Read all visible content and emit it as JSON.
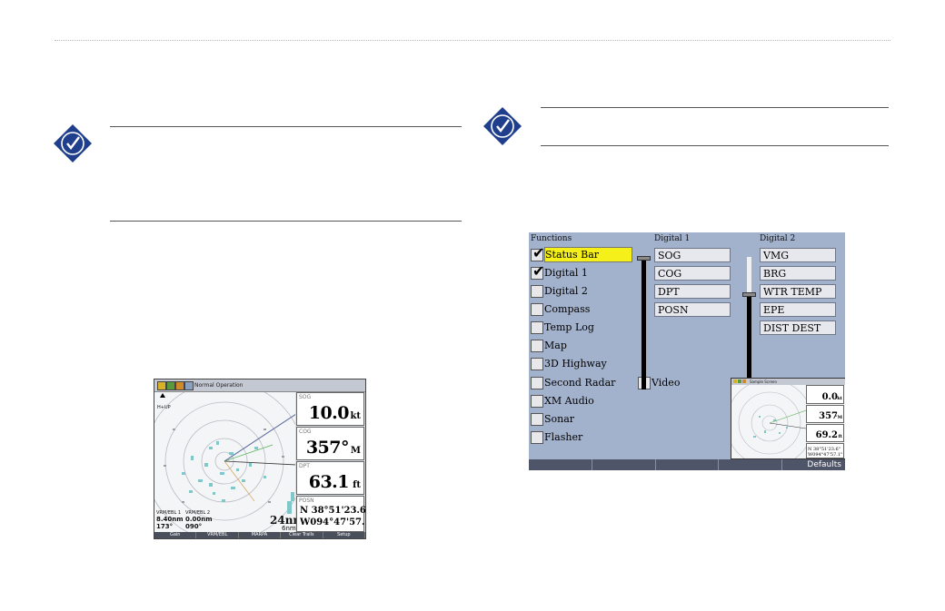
{
  "radar_screen": {
    "title": "Normal Operation",
    "panels": [
      {
        "label": "SOG",
        "value": "10.0",
        "unit": "kt"
      },
      {
        "label": "COG",
        "value": "357°",
        "unit": "M"
      },
      {
        "label": "DPT",
        "value": "63.1",
        "unit": "ft"
      }
    ],
    "posn": {
      "label": "POSN",
      "lat": "N  38°51'23.6\"",
      "lon": "W094°47'57.1\""
    },
    "range": "24nm",
    "range_sub": "6nm",
    "heading_mode": "H+UP",
    "readout_left_1": "VRM/EBL 1",
    "readout_left_2": "8.40nm",
    "readout_left_3": "173°",
    "readout_mid_1": "VRM/EBL 2",
    "readout_mid_2": "0.00nm",
    "readout_mid_3": "090°",
    "softkeys": [
      "Gain",
      "VRM/EBL",
      "MARPA",
      "Clear Trails",
      "Setup"
    ]
  },
  "layout_screen": {
    "functions_header": "Functions",
    "digital1_header": "Digital 1",
    "digital2_header": "Digital 2",
    "functions": [
      {
        "label": "Status Bar",
        "checked": true,
        "selected": true
      },
      {
        "label": "Digital 1",
        "checked": true,
        "selected": false
      },
      {
        "label": "Digital 2",
        "checked": false,
        "selected": false
      },
      {
        "label": "Compass",
        "checked": false,
        "selected": false
      },
      {
        "label": "Temp Log",
        "checked": false,
        "selected": false
      },
      {
        "label": "Map",
        "checked": false,
        "selected": false
      },
      {
        "label": "3D Highway",
        "checked": false,
        "selected": false
      },
      {
        "label": "Second Radar",
        "checked": false,
        "selected": false
      },
      {
        "label": "XM Audio",
        "checked": false,
        "selected": false
      },
      {
        "label": "Sonar",
        "checked": false,
        "selected": false
      },
      {
        "label": "Flasher",
        "checked": false,
        "selected": false
      }
    ],
    "video_label": "Video",
    "digital1_fields": [
      "SOG",
      "COG",
      "DPT",
      "POSN"
    ],
    "digital2_fields": [
      "VMG",
      "BRG",
      "WTR TEMP",
      "EPE",
      "DIST DEST"
    ],
    "softkeys": [
      "",
      "",
      "",
      "",
      "Defaults"
    ],
    "preview": {
      "title": "Sample Screen",
      "values": [
        {
          "value": "0.0",
          "unit": "kt"
        },
        {
          "value": "357",
          "unit": "°M"
        },
        {
          "value": "69.2",
          "unit": "ft"
        }
      ],
      "posn": "N 38°51'23.6\"",
      "posn2": "W094°47'57.1\""
    }
  }
}
